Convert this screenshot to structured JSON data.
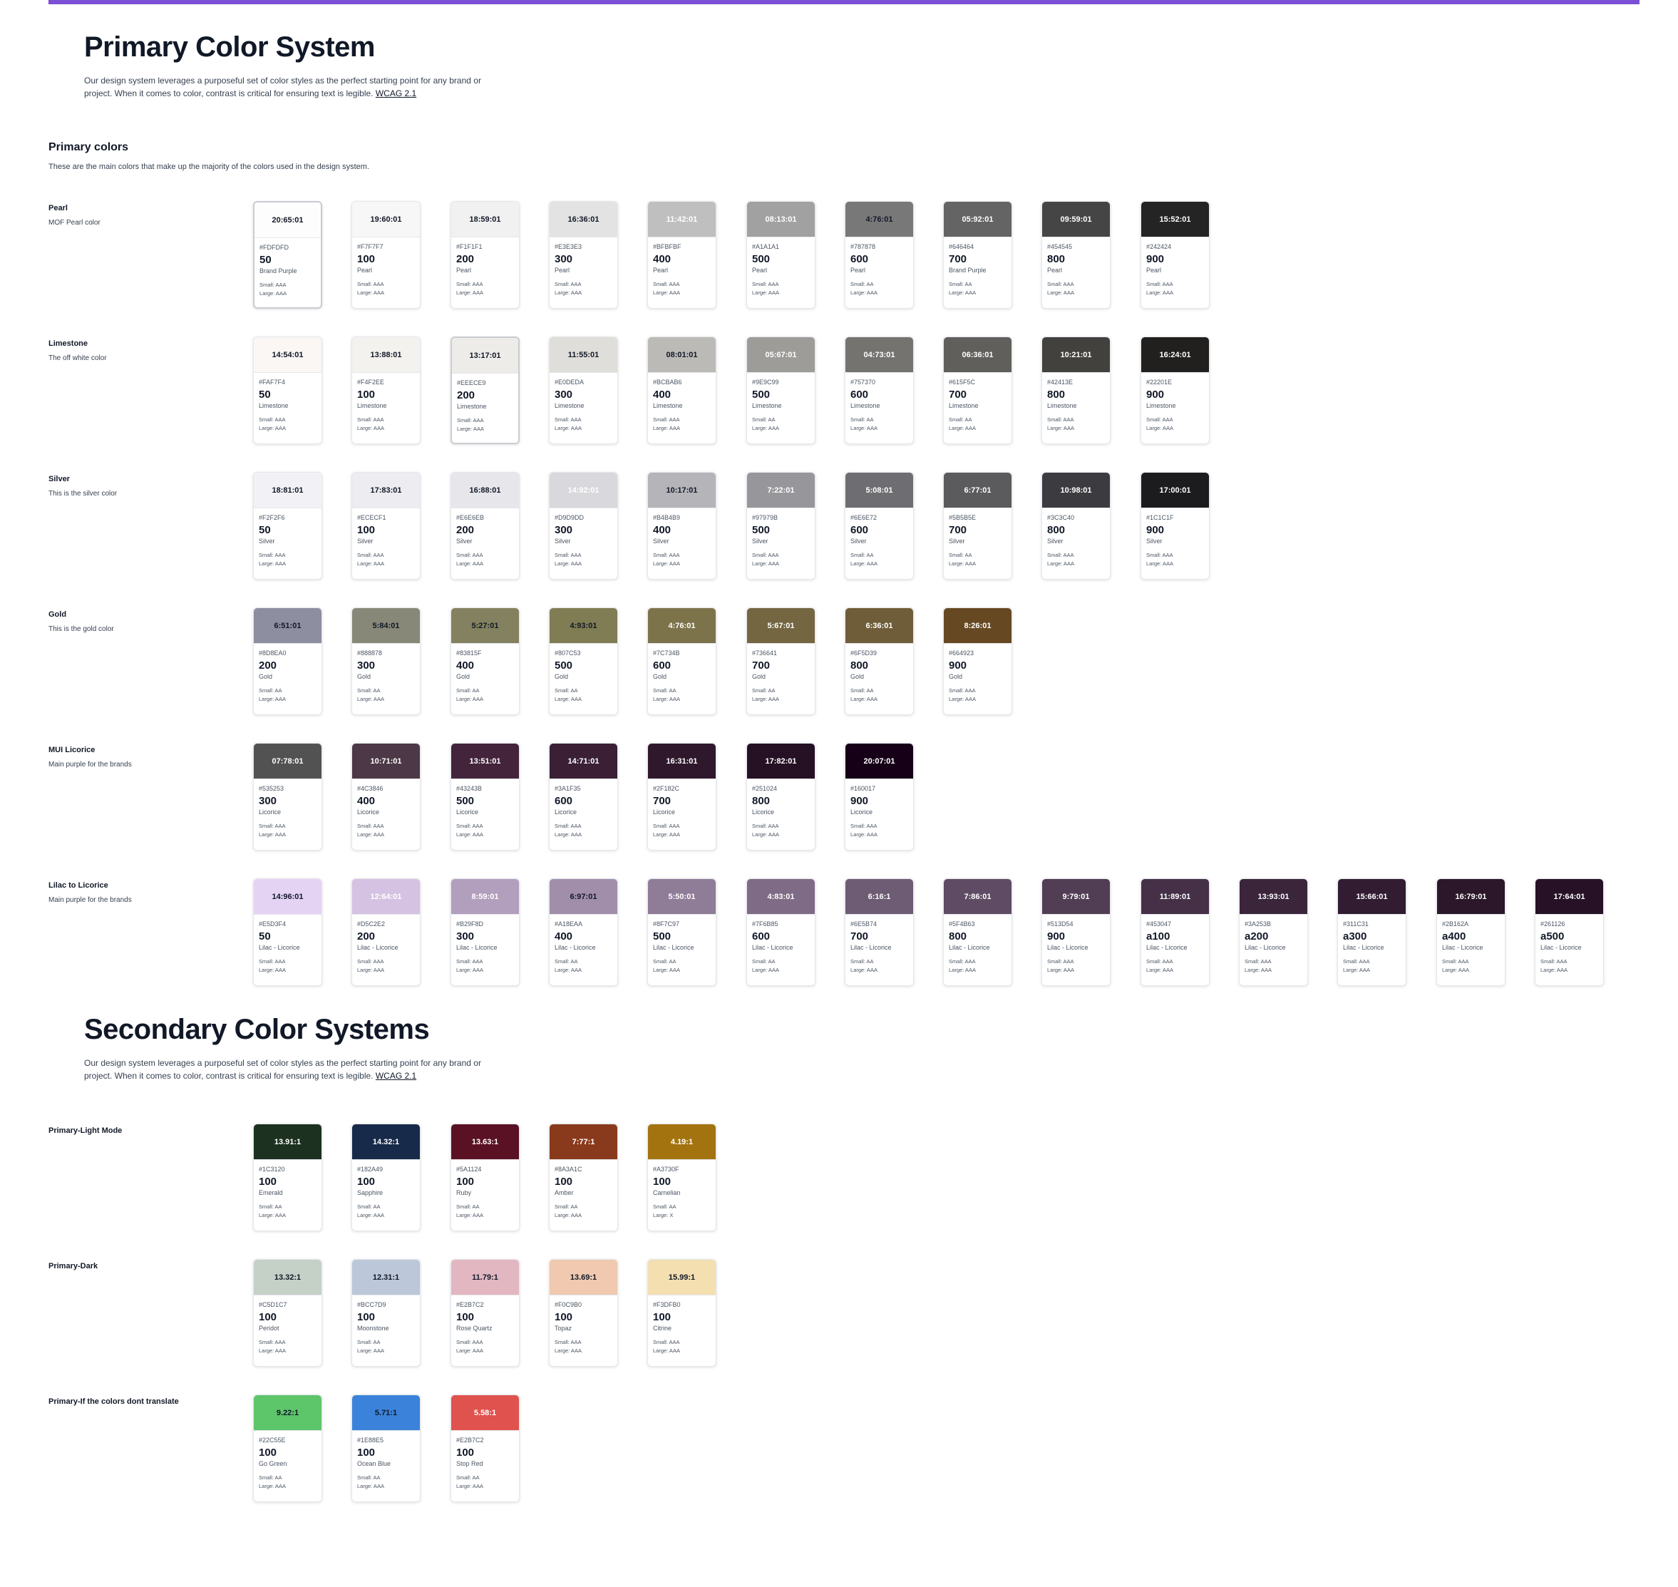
{
  "primary": {
    "title": "Primary Color System",
    "intro_line1": "Our design system leverages a purposeful set of color styles as the perfect starting point for any brand or",
    "intro_line2": "project. When it comes to color, contrast is critical for ensuring text is legible.",
    "intro_link": "WCAG 2.1",
    "section_heading": "Primary colors",
    "section_desc": "These are the main colors that make up the majority of the colors used in the design system."
  },
  "secondary": {
    "title": "Secondary Color Systems",
    "intro_line1": "Our design system leverages a purposeful set of color styles as the perfect starting point for any brand or",
    "intro_line2": "project. When it comes to color, contrast is critical for ensuring text is legible.",
    "intro_link": "WCAG 2.1"
  },
  "palettes": [
    {
      "name": "Pearl",
      "desc": "MOF Pearl color",
      "colors": [
        {
          "ratio": "20:65:01",
          "hex": "#FDFDFD",
          "step": "50",
          "name": "Brand Purple",
          "small": "Small: AAA",
          "large": "Large: AAA",
          "text": "#111827",
          "selected": true
        },
        {
          "ratio": "19:60:01",
          "hex": "#F7F7F7",
          "step": "100",
          "name": "Pearl",
          "small": "Small: AAA",
          "large": "Large: AAA",
          "text": "#111827"
        },
        {
          "ratio": "18:59:01",
          "hex": "#F1F1F1",
          "step": "200",
          "name": "Pearl",
          "small": "Small: AAA",
          "large": "Large: AAA",
          "text": "#111827"
        },
        {
          "ratio": "16:36:01",
          "hex": "#E3E3E3",
          "step": "300",
          "name": "Pearl",
          "small": "Small: AAA",
          "large": "Large: AAA",
          "text": "#111827"
        },
        {
          "ratio": "11:42:01",
          "hex": "#BFBFBF",
          "step": "400",
          "name": "Pearl",
          "small": "Small: AAA",
          "large": "Large: AAA",
          "text": "#ffffff"
        },
        {
          "ratio": "08:13:01",
          "hex": "#A1A1A1",
          "step": "500",
          "name": "Pearl",
          "small": "Small: AAA",
          "large": "Large: AAA",
          "text": "#ffffff"
        },
        {
          "ratio": "4:76:01",
          "hex": "#787878",
          "step": "600",
          "name": "Pearl",
          "small": "Small: AA",
          "large": "Large: AAA",
          "text": "#111827"
        },
        {
          "ratio": "05:92:01",
          "hex": "#646464",
          "step": "700",
          "name": "Brand Purple",
          "small": "Small: AA",
          "large": "Large: AAA",
          "text": "#ffffff"
        },
        {
          "ratio": "09:59:01",
          "hex": "#454545",
          "step": "800",
          "name": "Pearl",
          "small": "Small: AAA",
          "large": "Large: AAA",
          "text": "#ffffff"
        },
        {
          "ratio": "15:52:01",
          "hex": "#242424",
          "step": "900",
          "name": "Pearl",
          "small": "Small: AAA",
          "large": "Large: AAA",
          "text": "#ffffff"
        }
      ]
    },
    {
      "name": "Limestone",
      "desc": "The off white color",
      "colors": [
        {
          "ratio": "14:54:01",
          "hex": "#FAF7F4",
          "step": "50",
          "name": "Limestone",
          "small": "Small: AAA",
          "large": "Large: AAA",
          "text": "#111827"
        },
        {
          "ratio": "13:88:01",
          "hex": "#F4F2EE",
          "step": "100",
          "name": "Limestone",
          "small": "Small: AAA",
          "large": "Large: AAA",
          "text": "#111827"
        },
        {
          "ratio": "13:17:01",
          "hex": "#EEECE9",
          "step": "200",
          "name": "Limestone",
          "small": "Small: AAA",
          "large": "Large: AAA",
          "text": "#111827",
          "selected": true
        },
        {
          "ratio": "11:55:01",
          "hex": "#E0DEDA",
          "step": "300",
          "name": "Limestone",
          "small": "Small: AAA",
          "large": "Large: AAA",
          "text": "#111827"
        },
        {
          "ratio": "08:01:01",
          "hex": "#BCBAB6",
          "step": "400",
          "name": "Limestone",
          "small": "Small: AAA",
          "large": "Large: AAA",
          "text": "#111827"
        },
        {
          "ratio": "05:67:01",
          "hex": "#9E9C99",
          "step": "500",
          "name": "Limestone",
          "small": "Small: AA",
          "large": "Large: AAA",
          "text": "#ffffff"
        },
        {
          "ratio": "04:73:01",
          "hex": "#757370",
          "step": "600",
          "name": "Limestone",
          "small": "Small: AA",
          "large": "Large: AAA",
          "text": "#ffffff"
        },
        {
          "ratio": "06:36:01",
          "hex": "#615F5C",
          "step": "700",
          "name": "Limestone",
          "small": "Small: AA",
          "large": "Large: AAA",
          "text": "#ffffff"
        },
        {
          "ratio": "10:21:01",
          "hex": "#42413E",
          "step": "800",
          "name": "Limestone",
          "small": "Small: AAA",
          "large": "Large: AAA",
          "text": "#ffffff"
        },
        {
          "ratio": "16:24:01",
          "hex": "#22201E",
          "step": "900",
          "name": "Limestone",
          "small": "Small: AAA",
          "large": "Large: AAA",
          "text": "#ffffff"
        }
      ]
    },
    {
      "name": "Silver",
      "desc": "This is the silver color",
      "colors": [
        {
          "ratio": "18:81:01",
          "hex": "#F2F2F6",
          "step": "50",
          "name": "Silver",
          "small": "Small: AAA",
          "large": "Large: AAA",
          "text": "#111827"
        },
        {
          "ratio": "17:83:01",
          "hex": "#ECECF1",
          "step": "100",
          "name": "Silver",
          "small": "Small: AAA",
          "large": "Large: AAA",
          "text": "#111827"
        },
        {
          "ratio": "16:88:01",
          "hex": "#E6E6EB",
          "step": "200",
          "name": "Silver",
          "small": "Small: AAA",
          "large": "Large: AAA",
          "text": "#111827"
        },
        {
          "ratio": "14:92:01",
          "hex": "#D9D9DD",
          "step": "300",
          "name": "Silver",
          "small": "Small: AAA",
          "large": "Large: AAA",
          "text": "#ffffff"
        },
        {
          "ratio": "10:17:01",
          "hex": "#B4B4B9",
          "step": "400",
          "name": "Silver",
          "small": "Small: AAA",
          "large": "Large: AAA",
          "text": "#111827"
        },
        {
          "ratio": "7:22:01",
          "hex": "#97979B",
          "step": "500",
          "name": "Silver",
          "small": "Small: AAA",
          "large": "Large: AAA",
          "text": "#ffffff"
        },
        {
          "ratio": "5:08:01",
          "hex": "#6E6E72",
          "step": "600",
          "name": "Silver",
          "small": "Small: AA",
          "large": "Large: AAA",
          "text": "#ffffff"
        },
        {
          "ratio": "6:77:01",
          "hex": "#5B5B5E",
          "step": "700",
          "name": "Silver",
          "small": "Small: AA",
          "large": "Large: AAA",
          "text": "#ffffff"
        },
        {
          "ratio": "10:98:01",
          "hex": "#3C3C40",
          "step": "800",
          "name": "Silver",
          "small": "Small: AAA",
          "large": "Large: AAA",
          "text": "#ffffff"
        },
        {
          "ratio": "17:00:01",
          "hex": "#1C1C1F",
          "step": "900",
          "name": "Silver",
          "small": "Small: AAA",
          "large": "Large: AAA",
          "text": "#ffffff"
        }
      ]
    },
    {
      "name": "Gold",
      "desc": "This is the gold color",
      "colors": [
        {
          "ratio": "6:51:01",
          "hex": "#8D8EA0",
          "step": "200",
          "name": "Gold",
          "small": "Small: AA",
          "large": "Large: AAA",
          "text": "#111827"
        },
        {
          "ratio": "5:84:01",
          "hex": "#888878",
          "step": "300",
          "name": "Gold",
          "small": "Small: AA",
          "large": "Large: AAA",
          "text": "#111827"
        },
        {
          "ratio": "5:27:01",
          "hex": "#83815F",
          "step": "400",
          "name": "Gold",
          "small": "Small: AA",
          "large": "Large: AAA",
          "text": "#111827"
        },
        {
          "ratio": "4:93:01",
          "hex": "#807C53",
          "step": "500",
          "name": "Gold",
          "small": "Small: AA",
          "large": "Large: AAA",
          "text": "#111827"
        },
        {
          "ratio": "4:76:01",
          "hex": "#7C734B",
          "step": "600",
          "name": "Gold",
          "small": "Small: AA",
          "large": "Large: AAA",
          "text": "#ffffff"
        },
        {
          "ratio": "5:67:01",
          "hex": "#736641",
          "step": "700",
          "name": "Gold",
          "small": "Small: AA",
          "large": "Large: AAA",
          "text": "#ffffff"
        },
        {
          "ratio": "6:36:01",
          "hex": "#6F5D39",
          "step": "800",
          "name": "Gold",
          "small": "Small: AA",
          "large": "Large: AAA",
          "text": "#ffffff"
        },
        {
          "ratio": "8:26:01",
          "hex": "#664923",
          "step": "900",
          "name": "Gold",
          "small": "Small: AAA",
          "large": "Large: AAA",
          "text": "#ffffff"
        }
      ]
    },
    {
      "name": "MUI Licorice",
      "desc": "Main purple for the brands",
      "colors": [
        {
          "ratio": "07:78:01",
          "hex": "#535253",
          "step": "300",
          "name": "Licorice",
          "small": "Small: AAA",
          "large": "Large: AAA",
          "text": "#ffffff"
        },
        {
          "ratio": "10:71:01",
          "hex": "#4C3846",
          "step": "400",
          "name": "Licorice",
          "small": "Small: AAA",
          "large": "Large: AAA",
          "text": "#ffffff"
        },
        {
          "ratio": "13:51:01",
          "hex": "#43243B",
          "step": "500",
          "name": "Licorice",
          "small": "Small: AAA",
          "large": "Large: AAA",
          "text": "#ffffff"
        },
        {
          "ratio": "14:71:01",
          "hex": "#3A1F35",
          "step": "600",
          "name": "Licorice",
          "small": "Small: AAA",
          "large": "Large: AAA",
          "text": "#ffffff"
        },
        {
          "ratio": "16:31:01",
          "hex": "#2F182C",
          "step": "700",
          "name": "Licorice",
          "small": "Small: AAA",
          "large": "Large: AAA",
          "text": "#ffffff"
        },
        {
          "ratio": "17:82:01",
          "hex": "#251024",
          "step": "800",
          "name": "Licorice",
          "small": "Small: AAA",
          "large": "Large: AAA",
          "text": "#ffffff"
        },
        {
          "ratio": "20:07:01",
          "hex": "#160017",
          "step": "900",
          "name": "Licorice",
          "small": "Small: AAA",
          "large": "Large: AAA",
          "text": "#ffffff"
        }
      ]
    },
    {
      "name": "Lilac to Licorice",
      "desc": "Main purple for the brands",
      "colors": [
        {
          "ratio": "14:96:01",
          "hex": "#E5D3F4",
          "step": "50",
          "name": "Lilac - Licorice",
          "small": "Small: AAA",
          "large": "Large: AAA",
          "text": "#111827"
        },
        {
          "ratio": "12:64:01",
          "hex": "#D5C2E2",
          "step": "200",
          "name": "Lilac - Licorice",
          "small": "Small: AAA",
          "large": "Large: AAA",
          "text": "#ffffff"
        },
        {
          "ratio": "8:59:01",
          "hex": "#B29F8D",
          "step": "300",
          "name": "Lilac - Licorice",
          "small": "Small: AAA",
          "large": "Large: AAA",
          "text": "#ffffff"
        },
        {
          "ratio": "6:97:01",
          "hex": "#A18EAA",
          "step": "400",
          "name": "Lilac - Licorice",
          "small": "Small: AA",
          "large": "Large: AAA",
          "text": "#111827"
        },
        {
          "ratio": "5:50:01",
          "hex": "#8F7C97",
          "step": "500",
          "name": "Lilac - Licorice",
          "small": "Small: AA",
          "large": "Large: AAA",
          "text": "#ffffff"
        },
        {
          "ratio": "4:83:01",
          "hex": "#7F6B85",
          "step": "600",
          "name": "Lilac - Licorice",
          "small": "Small: AA",
          "large": "Large: AAA",
          "text": "#ffffff"
        },
        {
          "ratio": "6:16:1",
          "hex": "#6E5B74",
          "step": "700",
          "name": "Lilac - Licorice",
          "small": "Small: AA",
          "large": "Large: AAA",
          "text": "#ffffff"
        },
        {
          "ratio": "7:86:01",
          "hex": "#5F4B63",
          "step": "800",
          "name": "Lilac - Licorice",
          "small": "Small: AAA",
          "large": "Large: AAA",
          "text": "#ffffff"
        },
        {
          "ratio": "9:79:01",
          "hex": "#513D54",
          "step": "900",
          "name": "Lilac - Licorice",
          "small": "Small: AAA",
          "large": "Large: AAA",
          "text": "#ffffff"
        },
        {
          "ratio": "11:89:01",
          "hex": "#453047",
          "step": "a100",
          "name": "Lilac - Licorice",
          "small": "Small: AAA",
          "large": "Large: AAA",
          "text": "#ffffff"
        },
        {
          "ratio": "13:93:01",
          "hex": "#3A253B",
          "step": "a200",
          "name": "Lilac - Licorice",
          "small": "Small: AAA",
          "large": "Large: AAA",
          "text": "#ffffff"
        },
        {
          "ratio": "15:66:01",
          "hex": "#311C31",
          "step": "a300",
          "name": "Lilac - Licorice",
          "small": "Small: AAA",
          "large": "Large: AAA",
          "text": "#ffffff"
        },
        {
          "ratio": "16:79:01",
          "hex": "#2B162A",
          "step": "a400",
          "name": "Lilac - Licorice",
          "small": "Small: AAA",
          "large": "Large: AAA",
          "text": "#ffffff"
        },
        {
          "ratio": "17:64:01",
          "hex": "#261126",
          "step": "a500",
          "name": "Lilac - Licorice",
          "small": "Small: AAA",
          "large": "Large: AAA",
          "text": "#ffffff"
        }
      ]
    },
    {
      "name": "Primary-Light Mode",
      "desc": "",
      "colors": [
        {
          "ratio": "13.91:1",
          "hex": "#1C3120",
          "step": "100",
          "name": "Emerald",
          "small": "Small: AA",
          "large": "Large: AAA",
          "text": "#ffffff"
        },
        {
          "ratio": "14.32:1",
          "hex": "#182A49",
          "step": "100",
          "name": "Sapphire",
          "small": "Small: AA",
          "large": "Large: AAA",
          "text": "#ffffff"
        },
        {
          "ratio": "13.63:1",
          "hex": "#5A1124",
          "step": "100",
          "name": "Ruby",
          "small": "Small: AA",
          "large": "Large: AAA",
          "text": "#ffffff"
        },
        {
          "ratio": "7:77:1",
          "hex": "#8A3A1C",
          "step": "100",
          "name": "Amber",
          "small": "Small: AA",
          "large": "Large: AAA",
          "text": "#ffffff"
        },
        {
          "ratio": "4.19:1",
          "hex": "#A3730F",
          "step": "100",
          "name": "Carnelian",
          "small": "Small: AA",
          "large": "Large: X",
          "text": "#ffffff"
        }
      ]
    },
    {
      "name": "Primary-Dark",
      "desc": "",
      "colors": [
        {
          "ratio": "13.32:1",
          "hex": "#C5D1C7",
          "step": "100",
          "name": "Peridot",
          "small": "Small: AAA",
          "large": "Large: AAA",
          "text": "#111827"
        },
        {
          "ratio": "12.31:1",
          "hex": "#BCC7D9",
          "step": "100",
          "name": "Moonstone",
          "small": "Small: AA",
          "large": "Large: AAA",
          "text": "#111827"
        },
        {
          "ratio": "11.79:1",
          "hex": "#E2B7C2",
          "step": "100",
          "name": "Rose Quartz",
          "small": "Small: AAA",
          "large": "Large: AAA",
          "text": "#111827"
        },
        {
          "ratio": "13.69:1",
          "hex": "#F0C9B0",
          "step": "100",
          "name": "Topaz",
          "small": "Small: AAA",
          "large": "Large: AAA",
          "text": "#111827"
        },
        {
          "ratio": "15.99:1",
          "hex": "#F3DFB0",
          "step": "100",
          "name": "Citrine",
          "small": "Small: AAA",
          "large": "Large: AAA",
          "text": "#111827"
        }
      ]
    },
    {
      "name": "Primary-If the colors dont translate",
      "desc": "",
      "colors": [
        {
          "ratio": "9.22:1",
          "hex": "#22C55E",
          "step": "100",
          "name": "Go Green",
          "small": "Small: AA",
          "large": "Large: AAA",
          "text": "#111827"
        },
        {
          "ratio": "5.71:1",
          "hex": "#1E88E5",
          "step": "100",
          "name": "Ocean Blue",
          "small": "Small: AA",
          "large": "Large: AAA",
          "text": "#111827"
        },
        {
          "ratio": "5.58:1",
          "hex": "#E2B7C2",
          "step": "100",
          "name": "Stop Red",
          "small": "Small: AA",
          "large": "Large: AAA",
          "text": "#ffffff"
        }
      ]
    }
  ],
  "swatch_display": [
    "#FDFDFD",
    "#F7F7F7",
    "#F1F1F1",
    "#E3E3E3",
    "#BFBFBF",
    "#A1A1A1",
    "#787878",
    "#646464",
    "#454545",
    "#242424",
    "#FAF7F4",
    "#F4F2EE",
    "#EEECE9",
    "#E0DEDA",
    "#BCBAB6",
    "#9E9C99",
    "#757370",
    "#615F5C",
    "#42413E",
    "#22201E",
    "#F2F2F6",
    "#ECECF1",
    "#E6E6EB",
    "#D9D9DD",
    "#B4B4B9",
    "#97979B",
    "#6E6E72",
    "#5B5B5E",
    "#3C3C40",
    "#1C1C1F",
    "#8D8EA0",
    "#888878",
    "#83815F",
    "#807C53",
    "#7C734B",
    "#736641",
    "#6F5D39",
    "#664923",
    "#535253",
    "#4C3846",
    "#43243B",
    "#3A1F35",
    "#2F182C",
    "#251024",
    "#160017",
    "#E5D3F4",
    "#D5C2E2",
    "#B29FBD",
    "#A18EAA",
    "#8F7C97",
    "#7F6B85",
    "#6E5B74",
    "#5F4B63",
    "#513D54",
    "#453047",
    "#3A253B",
    "#311C31",
    "#2B162A",
    "#261126",
    "#1C3120",
    "#182A49",
    "#5A1124",
    "#8A3A1C",
    "#A3730F",
    "#C5D1C7",
    "#BCC7D9",
    "#E2B7C2",
    "#F0C9B0",
    "#F3DFB0",
    "#5DC56A",
    "#3B82DA",
    "#E0524E"
  ]
}
